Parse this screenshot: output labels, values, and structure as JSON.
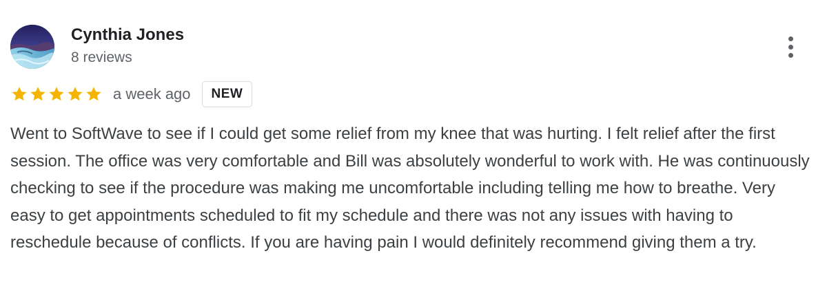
{
  "review": {
    "author": {
      "name": "Cynthia Jones",
      "review_count": "8 reviews",
      "avatar_icon": "profile-photo-icon"
    },
    "rating": 5,
    "max_rating": 5,
    "date": "a week ago",
    "badge": "NEW",
    "more_icon": "more-vertical-icon",
    "text": "Went to SoftWave to see if I could get some relief from my knee that was hurting. I felt relief after the first session. The office was very comfortable and Bill was absolutely wonderful to work with. He was continuously checking to see if the procedure was making me uncomfortable including telling me how to breathe. Very easy to get appointments scheduled to fit my schedule and there was not any issues with having to reschedule because of conflicts. If you are having pain I would definitely recommend giving them a try."
  },
  "colors": {
    "star": "#f4b400",
    "name": "#202124",
    "secondary_text": "#5f6368",
    "body_text": "#3c4043",
    "badge_border": "#dadce0"
  }
}
